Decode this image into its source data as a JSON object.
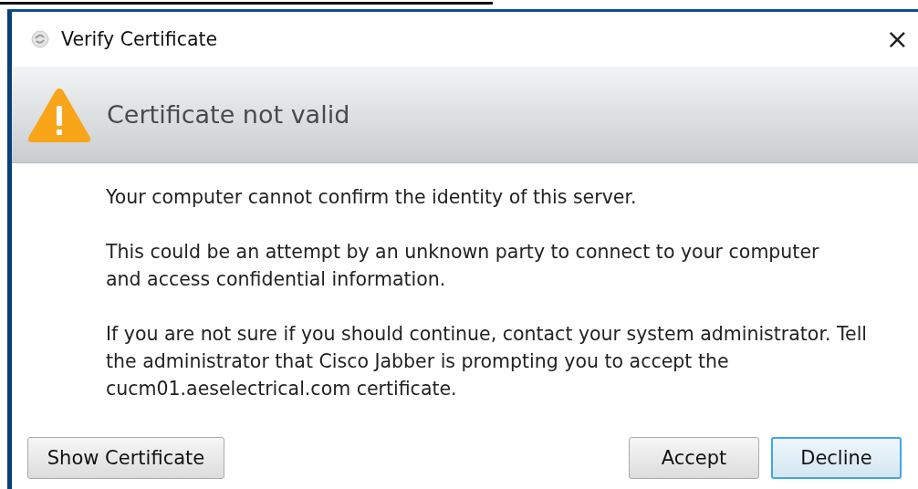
{
  "window": {
    "title": "Verify Certificate",
    "close": "×"
  },
  "header": {
    "title": "Certificate not valid"
  },
  "paragraphs": [
    "Your computer cannot confirm the identity of this server.",
    "This could be an attempt by an unknown party to connect to your computer and access confidential information.",
    "If you are not sure if you should continue, contact your system administrator. Tell the administrator that Cisco Jabber is prompting you to accept the cucm01.aeselectrical.com certificate."
  ],
  "left_buttons": [
    {
      "label": "Show Certificate",
      "focused": false
    }
  ],
  "right_buttons": [
    {
      "label": "Accept",
      "focused": false
    },
    {
      "label": "Decline",
      "focused": true
    }
  ]
}
